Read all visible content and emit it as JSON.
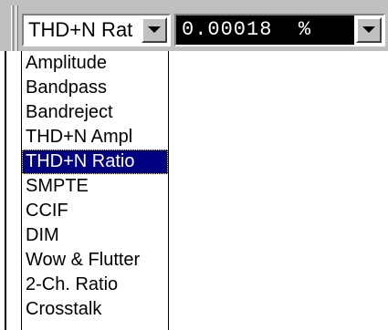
{
  "measurement_combo": {
    "value": "THD+N Rat"
  },
  "reading_combo": {
    "value": "0.00018  %"
  },
  "dropdown": {
    "items": [
      "Amplitude",
      "Bandpass",
      "Bandreject",
      "THD+N Ampl",
      "THD+N Ratio",
      "SMPTE",
      "CCIF",
      "DIM",
      "Wow & Flutter",
      "2-Ch. Ratio",
      "Crosstalk"
    ],
    "selected": "THD+N Ratio"
  },
  "colors": {
    "selection_bg": "#000080",
    "reading_bg": "#000000",
    "toolbar_bg": "#c0c0c0"
  }
}
